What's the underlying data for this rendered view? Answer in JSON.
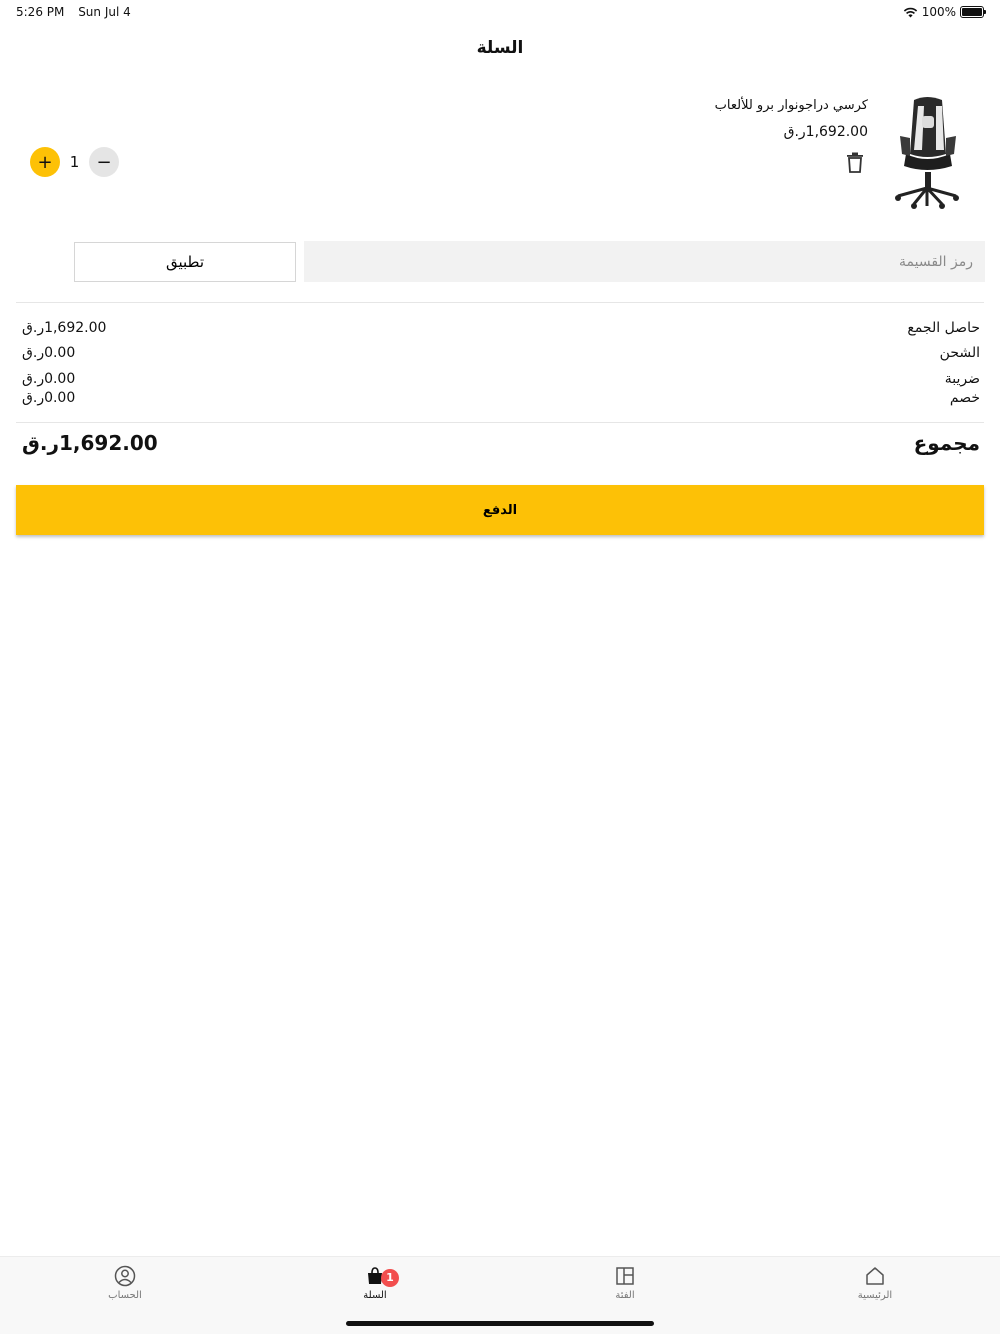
{
  "status_bar": {
    "time": "5:26 PM",
    "date": "Sun Jul 4",
    "battery": "100%",
    "battery_level": 1.0
  },
  "header": {
    "title": "السلة"
  },
  "cart": {
    "items": [
      {
        "name": "كرسي دراجونوار برو للألعاب",
        "price": "1,692.00ر.ق",
        "quantity": "1",
        "image_icon": "gaming-chair-image"
      }
    ]
  },
  "coupon": {
    "placeholder": "رمز القسيمة",
    "apply_label": "تطبيق"
  },
  "summary": {
    "subtotal_label": "حاصل الجمع",
    "subtotal_value": "1,692.00ر.ق",
    "shipping_label": "الشحن",
    "shipping_value": "0.00ر.ق",
    "tax_label": "ضريبة",
    "tax_value": "0.00ر.ق",
    "discount_label": "خصم",
    "discount_value": "0.00ر.ق",
    "total_label": "مجموع",
    "total_value": "1,692.00ر.ق"
  },
  "checkout": {
    "label": "الدفع"
  },
  "tab_bar": {
    "tabs": [
      {
        "label": "الحساب",
        "icon": "account-icon"
      },
      {
        "label": "السلة",
        "icon": "cart-icon",
        "badge": "1"
      },
      {
        "label": "الفئة",
        "icon": "category-icon"
      },
      {
        "label": "الرئيسية",
        "icon": "home-icon"
      }
    ]
  },
  "colors": {
    "accent": "#fdc106",
    "badge": "#f24e4e",
    "input_bg": "#f2f2f2"
  }
}
